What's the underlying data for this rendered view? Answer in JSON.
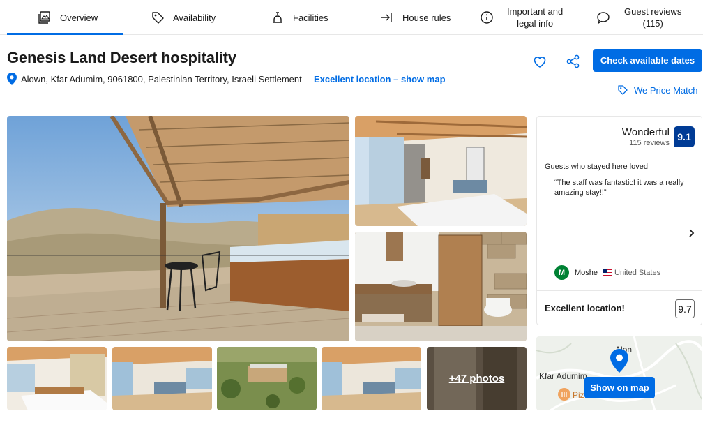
{
  "tabs": [
    {
      "label": "Overview",
      "icon": "overview-icon"
    },
    {
      "label": "Availability",
      "icon": "tag-icon"
    },
    {
      "label": "Facilities",
      "icon": "bell-icon"
    },
    {
      "label": "House rules",
      "icon": "enter-icon"
    },
    {
      "label_line1": "Important and",
      "label_line2": "legal info",
      "icon": "info-icon"
    },
    {
      "label_line1": "Guest reviews",
      "label_line2": "(115)",
      "icon": "speech-bubble-icon"
    }
  ],
  "property": {
    "title": "Genesis Land Desert hospitality",
    "address": "Alown, Kfar Adumim, 9061800, Palestinian Territory, Israeli Settlement",
    "separator": "–",
    "map_link": "Excellent location – show map"
  },
  "actions": {
    "check_dates": "Check available dates",
    "price_match": "We Price Match"
  },
  "gallery": {
    "more_photos": "+47 photos"
  },
  "reviews": {
    "rating_word": "Wonderful",
    "review_count": "115 reviews",
    "score": "9.1",
    "loved_title": "Guests who stayed here loved",
    "quote": "“The staff was fantastic! it was a really amazing stay!!”",
    "reviewer_initial": "M",
    "reviewer_name": "Moshe",
    "reviewer_country": "United States",
    "location_label": "Excellent location!",
    "location_score": "9.7"
  },
  "map": {
    "place_1": "Kfar Adumim",
    "place_2": "Alon",
    "place_3": "Piz",
    "button": "Show on map"
  },
  "colors": {
    "brand_blue": "#006ce4",
    "score_navy": "#003b95",
    "avatar_green": "#008234"
  }
}
